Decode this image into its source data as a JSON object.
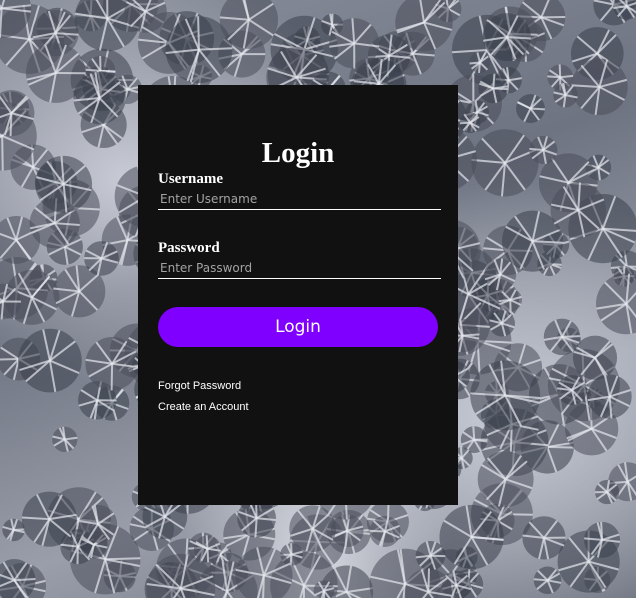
{
  "login": {
    "title": "Login",
    "username_label": "Username",
    "username_placeholder": "Enter Username",
    "password_label": "Password",
    "password_placeholder": "Enter Password",
    "submit_label": "Login",
    "forgot_password": "Forgot Password",
    "create_account": "Create an Account"
  },
  "colors": {
    "card_background": "#111111",
    "button_accent": "#7f00ff",
    "text": "#ffffff"
  }
}
